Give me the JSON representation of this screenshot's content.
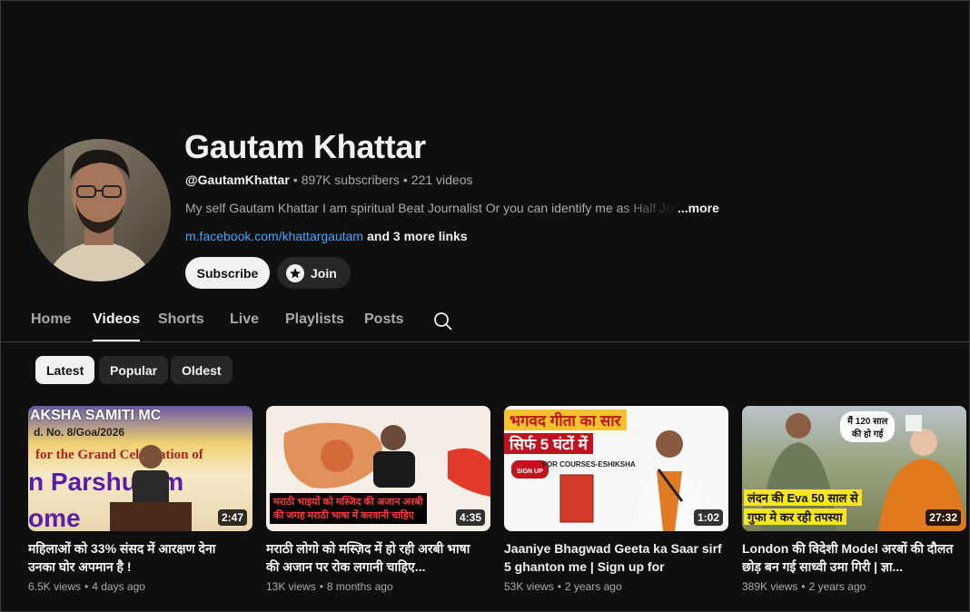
{
  "channel": {
    "name": "Gautam Khattar",
    "handle": "@GautamKhattar",
    "subscribers": "897K subscribers",
    "videos_count": "221 videos",
    "separator": "•",
    "description": "My self Gautam Khattar I am spiritual Beat Journalist Or you can identify me as Half Jour",
    "more_label": "...more",
    "link": "m.facebook.com/khattargautam",
    "more_links": "and 3 more links"
  },
  "buttons": {
    "subscribe": "Subscribe",
    "join": "Join"
  },
  "tabs": [
    "Home",
    "Videos",
    "Shorts",
    "Live",
    "Playlists",
    "Posts"
  ],
  "active_tab": "Videos",
  "chips": [
    "Latest",
    "Popular",
    "Oldest"
  ],
  "active_chip": "Latest",
  "videos": [
    {
      "title": "महिलाओं को 33% संसद में आरक्षण देना उनका घोर अपमान है !",
      "views": "6.5K views",
      "age": "4 days ago",
      "duration": "2:47",
      "thumb_text": [
        "AKSHA SAMITI MC",
        "d. No. 8/Goa/2026",
        "for the Grand Celebration of",
        "n Parshuram",
        "ome"
      ]
    },
    {
      "title": "मराठी लोगो को मस्ज़िद में हो रही अरबी भाषा की अजान पर रोक लगानी चाहिए...",
      "views": "13K views",
      "age": "8 months ago",
      "duration": "4:35",
      "thumb_text": [
        "मराठी भाइयों को मस्जिद की अजान अरबी",
        "की जगह मराठी भाषा में करवानी चाहिए"
      ]
    },
    {
      "title": "Jaaniye Bhagwad Geeta ka Saar sirf 5 ghanton me | Sign up for Course...",
      "views": "53K views",
      "age": "2 years ago",
      "duration": "1:02",
      "thumb_text": [
        "भगवद गीता का सार",
        "सिर्फ 5 घंटों में",
        "SIGN UP",
        "FOR COURSES-ESHIKSHA"
      ]
    },
    {
      "title": "London की विदेशी Model अरबों की दौलत छोड़ बन गई साध्वी उमा गिरी | ज्ञा...",
      "views": "389K views",
      "age": "2 years ago",
      "duration": "27:32",
      "thumb_text": [
        "मैं 120 साल",
        "की हो गई",
        "लंदन की Eva 50 साल से",
        "गुफा मे कर रही तपस्या"
      ]
    }
  ],
  "colors": {
    "background": "#0f0f0f",
    "link": "#3ea6ff",
    "text": "#f1f1f1",
    "muted": "#aaaaaa"
  }
}
